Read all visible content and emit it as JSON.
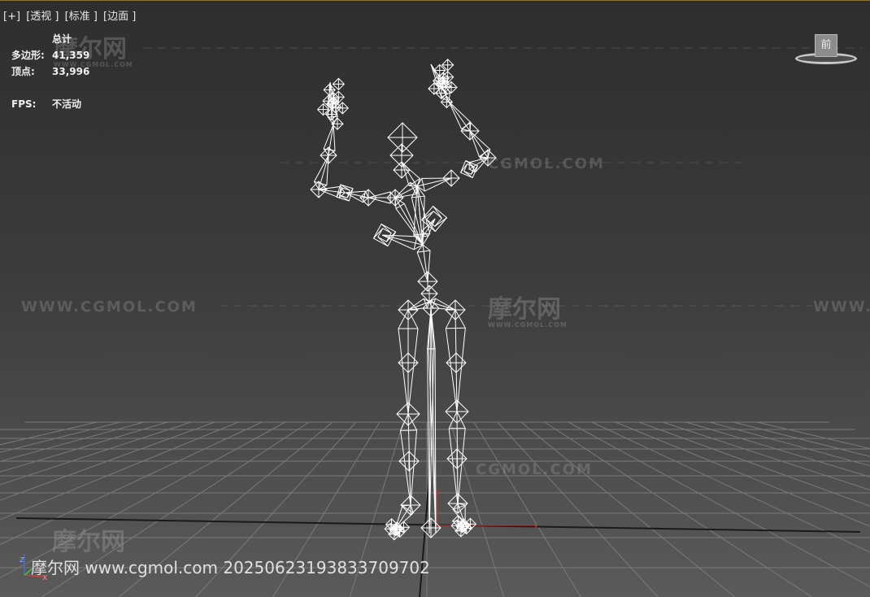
{
  "viewport_labels": [
    "[+]",
    "[透视 ]",
    "[标准 ]",
    "[边面 ]"
  ],
  "stats": {
    "header": "总计",
    "polygons_label": "多边形:",
    "polygons_value": "41,359",
    "vertices_label": "顶点:",
    "vertices_value": "33,996",
    "fps_label": "FPS:",
    "fps_value": "不活动"
  },
  "viewcube_label": "前",
  "watermark": {
    "site": "WWW.CGMOL.COM",
    "site_short": "CGMOL.COM",
    "logo": "摩尔网",
    "logo_sub": "WWW.CGMOL.COM"
  },
  "footer": "摩尔网 www.cgmol.com 20250623193833709702",
  "axis": {
    "x_label": "x",
    "y_label": "y",
    "z_label": "z"
  },
  "colors": {
    "wire": "#ffffff",
    "grid": "#7a7a7a",
    "x_axis": "#c83232",
    "y_axis": "#c83232"
  }
}
